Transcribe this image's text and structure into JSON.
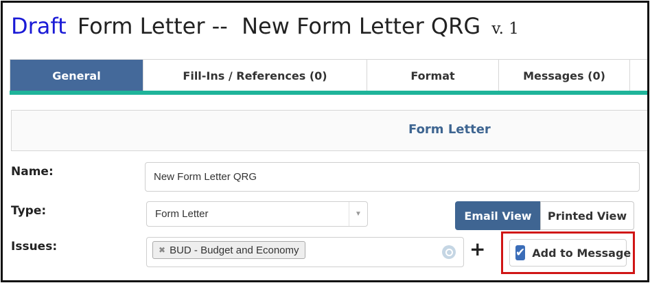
{
  "header": {
    "status": "Draft",
    "title": "Form Letter --  New Form Letter QRG",
    "version": "v. 1"
  },
  "tabs": [
    {
      "label": "General",
      "active": true
    },
    {
      "label": "Fill-Ins / References (0)",
      "active": false
    },
    {
      "label": "Format",
      "active": false
    },
    {
      "label": "Messages (0)",
      "active": false
    }
  ],
  "section": {
    "title": "Form Letter"
  },
  "form": {
    "name_label": "Name:",
    "name_value": "New Form Letter QRG",
    "type_label": "Type:",
    "type_value": "Form Letter",
    "issues_label": "Issues:",
    "issues_tags": [
      {
        "label": "BUD - Budget and Economy"
      }
    ]
  },
  "view_toggle": {
    "email_label": "Email View",
    "printed_label": "Printed View",
    "selected": "Email View"
  },
  "add_to_message": {
    "label": "Add to Message",
    "checked": true
  },
  "colors": {
    "accent": "#44699a",
    "tab_underline": "#1fb49a",
    "draft": "#1a1ad6",
    "highlight": "#d01515"
  }
}
